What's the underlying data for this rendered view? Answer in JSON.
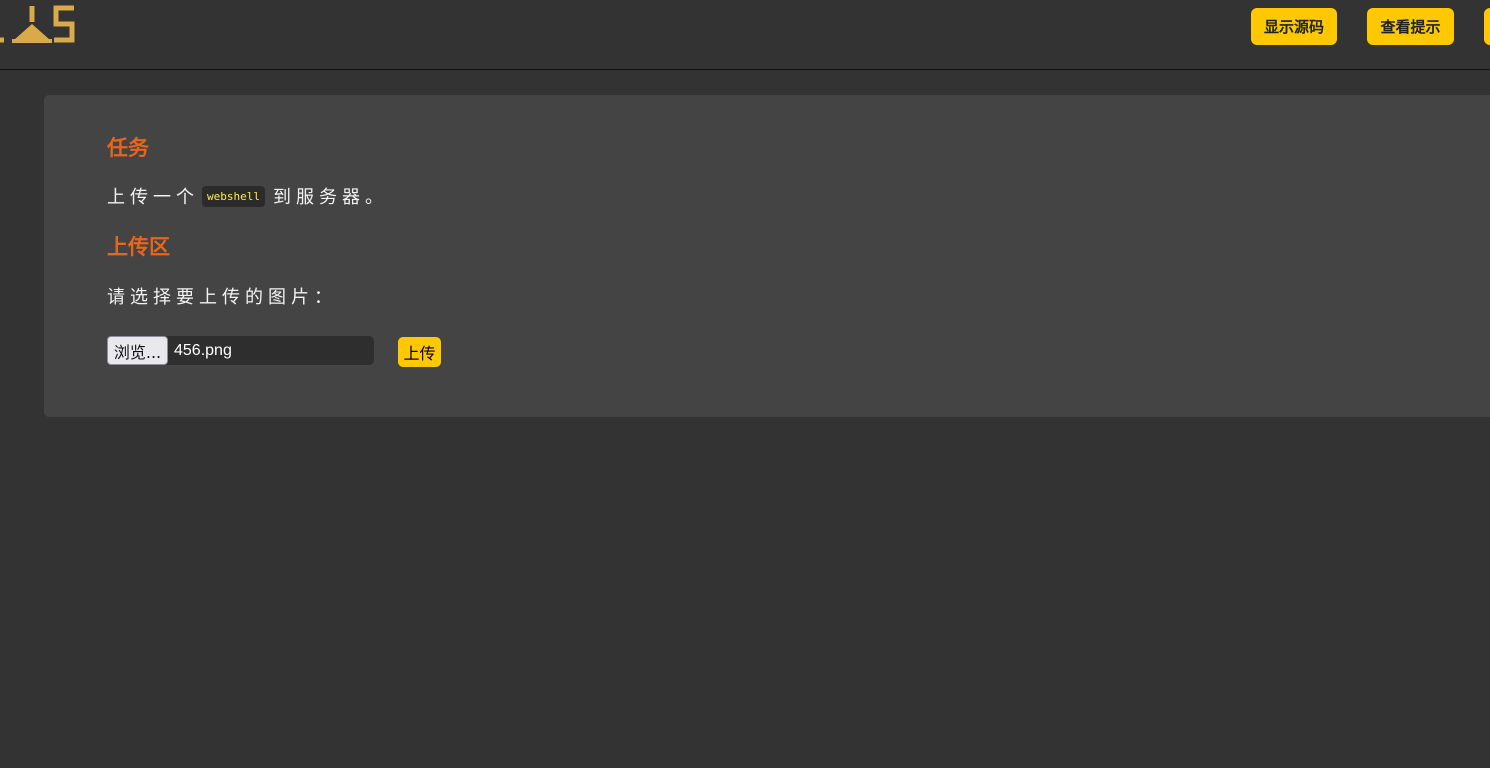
{
  "header": {
    "logo_icon": "ujs-logo-icon",
    "buttons": {
      "show_source": "显示源码",
      "view_hint": "查看提示"
    }
  },
  "task": {
    "title": "任务",
    "text_before": "上传一个",
    "code": "webshell",
    "text_after": "到服务器。"
  },
  "upload": {
    "title": "上传区",
    "prompt": "请选择要上传的图片：",
    "browse_label": "浏览...",
    "file_name": "456.png",
    "submit_label": "上传"
  },
  "colors": {
    "background": "#333333",
    "panel": "#444444",
    "accent": "#ffc800",
    "heading": "#e8651c",
    "code_text": "#ffe94a"
  }
}
